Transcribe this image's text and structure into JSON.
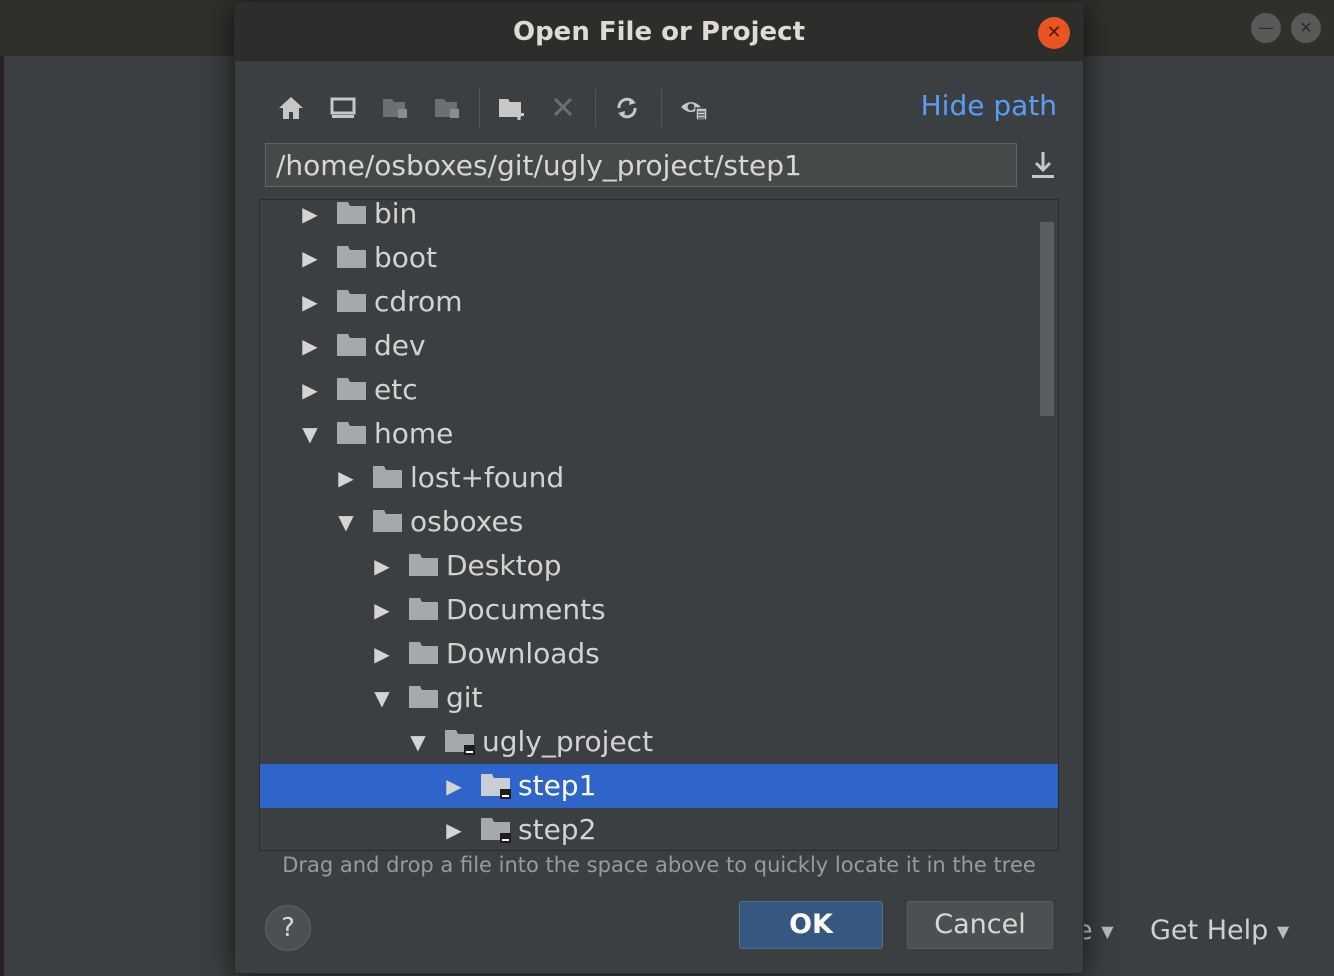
{
  "background": {
    "menus": [
      {
        "label": "e"
      },
      {
        "label": "Get Help"
      }
    ]
  },
  "dialog": {
    "title": "Open File or Project",
    "toolbar": {
      "icons": [
        "home-icon",
        "desktop-icon",
        "project-icon",
        "module-icon",
        "new-folder-icon",
        "delete-icon",
        "refresh-icon",
        "show-hidden-icon"
      ],
      "hide_path_label": "Hide path"
    },
    "path": "/home/osboxes/git/ugly_project/step1",
    "tree": [
      {
        "label": "bin",
        "level": 0,
        "expanded": false
      },
      {
        "label": "boot",
        "level": 0,
        "expanded": false
      },
      {
        "label": "cdrom",
        "level": 0,
        "expanded": false
      },
      {
        "label": "dev",
        "level": 0,
        "expanded": false
      },
      {
        "label": "etc",
        "level": 0,
        "expanded": false
      },
      {
        "label": "home",
        "level": 0,
        "expanded": true
      },
      {
        "label": "lost+found",
        "level": 1,
        "expanded": false
      },
      {
        "label": "osboxes",
        "level": 1,
        "expanded": true
      },
      {
        "label": "Desktop",
        "level": 2,
        "expanded": false
      },
      {
        "label": "Documents",
        "level": 2,
        "expanded": false
      },
      {
        "label": "Downloads",
        "level": 2,
        "expanded": false
      },
      {
        "label": "git",
        "level": 2,
        "expanded": true
      },
      {
        "label": "ugly_project",
        "level": 3,
        "expanded": true
      },
      {
        "label": "step1",
        "level": 4,
        "expanded": false,
        "selected": true
      },
      {
        "label": "step2",
        "level": 4,
        "expanded": false
      }
    ],
    "hint": "Drag and drop a file into the space above to quickly locate it in the tree",
    "help_label": "?",
    "ok_label": "OK",
    "cancel_label": "Cancel"
  },
  "colors": {
    "selection": "#2f65ca",
    "link": "#589df6",
    "close": "#e95420",
    "default_button": "#365880"
  }
}
